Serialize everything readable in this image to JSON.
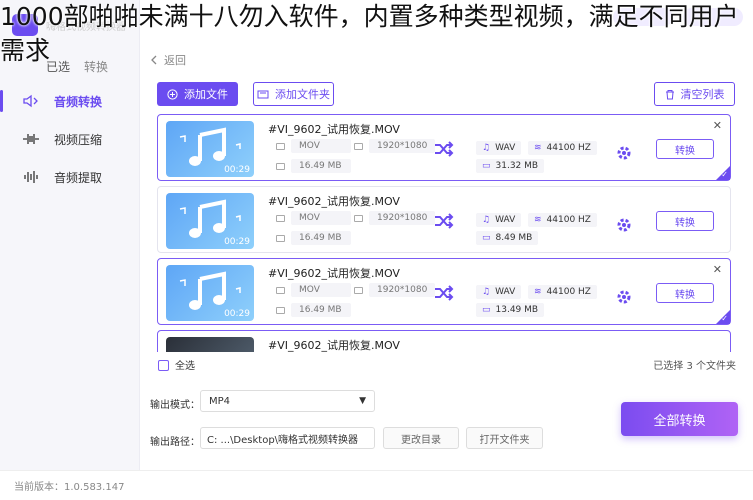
{
  "overlay_text": "1000部啪啪未满十八勿入软件，内置多种类型视频，满足不同用户需求",
  "app": {
    "name": "嗨格式视频转换器",
    "back_label": "返回",
    "side_label": "已选",
    "side_label2": "转换"
  },
  "sidebar": {
    "items": [
      {
        "label": "音频转换",
        "icon": "audio-convert-icon",
        "active": true
      },
      {
        "label": "视频压缩",
        "icon": "compress-icon",
        "active": false
      },
      {
        "label": "音频提取",
        "icon": "extract-icon",
        "active": false
      }
    ],
    "version": "当前版本：1.0.583.147"
  },
  "toolbar": {
    "add_file": "添加文件",
    "add_folder": "添加文件夹",
    "clear_list": "清空列表"
  },
  "files": [
    {
      "name": "#VI_9602_试用恢复.MOV",
      "format": "MOV",
      "resolution": "1920*1080",
      "size": "16.49 MB",
      "duration": "00:29",
      "out_format": "WAV",
      "out_rate": "44100 HZ",
      "out_size": "31.32 MB",
      "action": "转换",
      "selected": true,
      "thumb": "music"
    },
    {
      "name": "#VI_9602_试用恢复.MOV",
      "format": "MOV",
      "resolution": "1920*1080",
      "size": "16.49 MB",
      "duration": "00:29",
      "out_format": "WAV",
      "out_rate": "44100 HZ",
      "out_size": "8.49 MB",
      "action": "转换",
      "selected": false,
      "thumb": "music"
    },
    {
      "name": "#VI_9602_试用恢复.MOV",
      "format": "MOV",
      "resolution": "1920*1080",
      "size": "16.49 MB",
      "duration": "00:29",
      "out_format": "WAV",
      "out_rate": "44100 HZ",
      "out_size": "13.49 MB",
      "action": "转换",
      "selected": true,
      "thumb": "music"
    },
    {
      "name": "#VI_9602_试用恢复.MOV",
      "selected": true,
      "thumb": "dark"
    }
  ],
  "footer": {
    "select_all": "全选",
    "selected_count": "已选择 3 个文件夹"
  },
  "output": {
    "mode_label": "输出模式：",
    "mode_value": "MP4",
    "path_label": "输出路径：",
    "path_value": "C: ...\\Desktop\\嗨格式视频转换器",
    "change_dir": "更改目录",
    "open_folder": "打开文件夹",
    "convert_all": "全部转换"
  },
  "colors": {
    "accent": "#6b4cf0",
    "thumb": "#5ea6f6"
  }
}
